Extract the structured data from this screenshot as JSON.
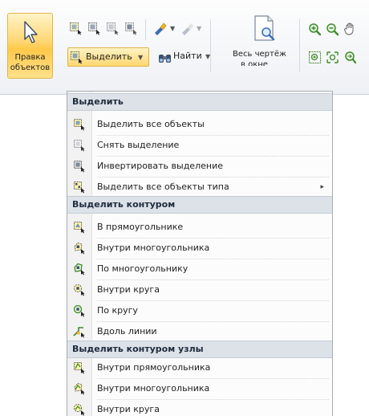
{
  "ribbon": {
    "edit_objects_label": [
      "Правка",
      "объектов"
    ],
    "select_button_label": "Выделить",
    "find_button_label": "Найти",
    "whole_drawing_label": [
      "Весь чертёж",
      "в окне"
    ],
    "icons": [
      "cursor-icon",
      "select-icon",
      "select-window-icon",
      "paint-icon",
      "magnify-icon",
      "zoom-in-icon",
      "zoom-out-icon",
      "pan-icon"
    ]
  },
  "menu": {
    "sections": [
      {
        "header": "Выделить",
        "items": [
          {
            "label": "Выделить все объекты",
            "icon": "select-all-icon"
          },
          {
            "label": "Снять выделение",
            "icon": "deselect-icon"
          },
          {
            "label": "Инвертировать выделение",
            "icon": "invert-selection-icon"
          },
          {
            "label": "Выделить все объекты типа",
            "icon": "select-by-type-icon",
            "submenu": true
          }
        ]
      },
      {
        "header": "Выделить контуром",
        "items": [
          {
            "label": "В прямоугольнике",
            "icon": "rect-select-icon"
          },
          {
            "label": "Внутри многоугольника",
            "icon": "polygon-inside-icon"
          },
          {
            "label": "По многоугольнику",
            "icon": "polygon-along-icon"
          },
          {
            "label": "Внутри круга",
            "icon": "circle-inside-icon"
          },
          {
            "label": "По кругу",
            "icon": "circle-along-icon"
          },
          {
            "label": "Вдоль линии",
            "icon": "along-line-icon"
          }
        ]
      },
      {
        "header": "Выделить контуром узлы",
        "items": [
          {
            "label": "Внутри прямоугольника",
            "icon": "nodes-rect-icon"
          },
          {
            "label": "Внутри многоугольника",
            "icon": "nodes-polygon-icon"
          },
          {
            "label": "Внутри круга",
            "icon": "nodes-circle-icon"
          }
        ]
      }
    ],
    "submenu_arrow": "▸"
  }
}
